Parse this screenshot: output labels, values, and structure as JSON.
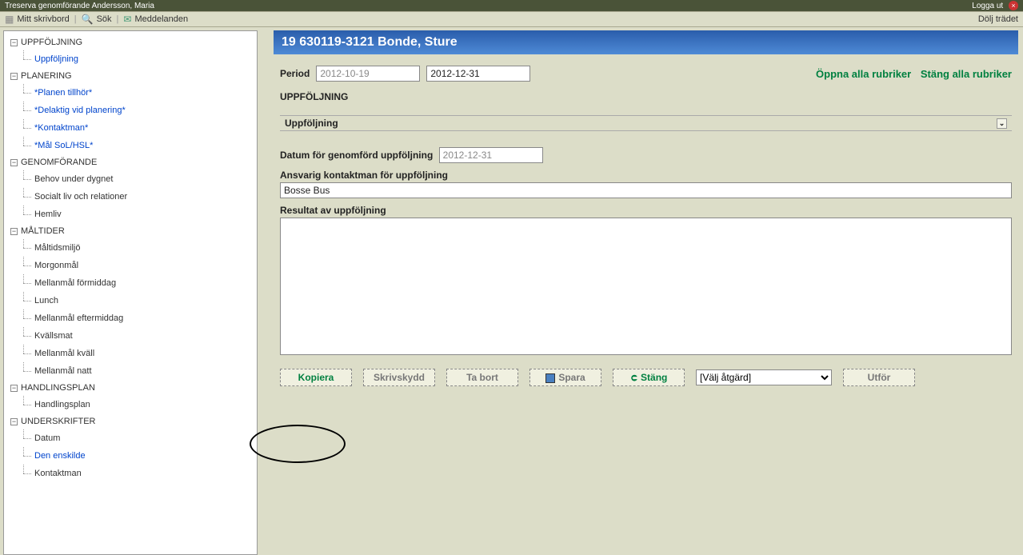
{
  "topbar": {
    "title_prefix": "Treserva genomförande",
    "user": "Andersson, Maria",
    "logout": "Logga ut"
  },
  "menubar": {
    "desktop": "Mitt skrivbord",
    "search": "Sök",
    "messages": "Meddelanden",
    "hide_tree": "Dölj trädet"
  },
  "tree": {
    "groups": [
      {
        "label": "UPPFÖLJNING",
        "items": [
          {
            "label": "Uppföljning",
            "blue": true
          }
        ]
      },
      {
        "label": "PLANERING",
        "items": [
          {
            "label": "*Planen tillhör*",
            "blue": true
          },
          {
            "label": "*Delaktig vid planering*",
            "blue": true
          },
          {
            "label": "*Kontaktman*",
            "blue": true
          },
          {
            "label": "*Mål SoL/HSL*",
            "blue": true
          }
        ]
      },
      {
        "label": "GENOMFÖRANDE",
        "items": [
          {
            "label": "Behov under dygnet",
            "blue": false
          },
          {
            "label": "Socialt liv och relationer",
            "blue": false
          },
          {
            "label": "Hemliv",
            "blue": false
          }
        ]
      },
      {
        "label": "MÅLTIDER",
        "items": [
          {
            "label": "Måltidsmiljö",
            "blue": false
          },
          {
            "label": "Morgonmål",
            "blue": false
          },
          {
            "label": "Mellanmål förmiddag",
            "blue": false
          },
          {
            "label": "Lunch",
            "blue": false
          },
          {
            "label": "Mellanmål eftermiddag",
            "blue": false
          },
          {
            "label": "Kvällsmat",
            "blue": false
          },
          {
            "label": "Mellanmål kväll",
            "blue": false
          },
          {
            "label": "Mellanmål natt",
            "blue": false
          }
        ]
      },
      {
        "label": "HANDLINGSPLAN",
        "items": [
          {
            "label": "Handlingsplan",
            "blue": false
          }
        ]
      },
      {
        "label": "UNDERSKRIFTER",
        "items": [
          {
            "label": "Datum",
            "blue": false
          },
          {
            "label": "Den enskilde",
            "blue": true
          },
          {
            "label": "Kontaktman",
            "blue": false
          }
        ]
      }
    ]
  },
  "header": {
    "title": "19 630119-3121 Bonde, Sture"
  },
  "period": {
    "label": "Period",
    "start": "2012-10-19",
    "end": "2012-12-31"
  },
  "links": {
    "open_all": "Öppna alla rubriker",
    "close_all": "Stäng alla rubriker"
  },
  "section": {
    "uppfoljning": "UPPFÖLJNING",
    "bar": "Uppföljning"
  },
  "fields": {
    "datum_label": "Datum för genomförd uppföljning",
    "datum_value": "2012-12-31",
    "ansvarig_label": "Ansvarig kontaktman för uppföljning",
    "ansvarig_value": "Bosse Bus",
    "resultat_label": "Resultat av uppföljning",
    "resultat_value": ""
  },
  "buttons": {
    "kopiera": "Kopiera",
    "skrivskydd": "Skrivskydd",
    "tabort": "Ta bort",
    "spara": "Spara",
    "stang": "Stäng",
    "utfor": "Utför"
  },
  "action_select": "[Välj åtgärd]"
}
